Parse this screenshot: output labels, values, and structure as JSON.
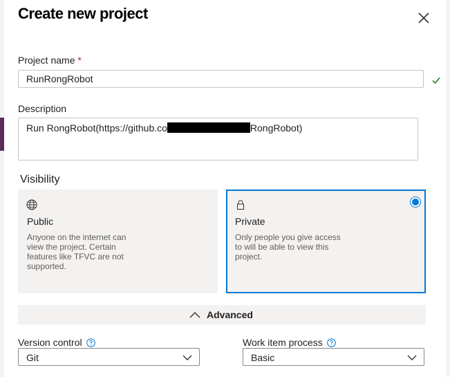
{
  "dialog": {
    "title": "Create new project",
    "project_name": {
      "label": "Project name",
      "required_marker": "*",
      "value": "RunRongRobot"
    },
    "description": {
      "label": "Description",
      "value_prefix": "Run RongRobot(https://github.co",
      "value_suffix": "RongRobot)"
    },
    "visibility": {
      "title": "Visibility",
      "options": [
        {
          "title": "Public",
          "description": "Anyone on the internet can view the project. Certain features like TFVC are not supported.",
          "icon": "globe-icon",
          "selected": false
        },
        {
          "title": "Private",
          "description": "Only people you give access to will be able to view this project.",
          "icon": "lock-icon",
          "selected": true
        }
      ]
    },
    "advanced": {
      "label": "Advanced"
    },
    "version_control": {
      "label": "Version control",
      "value": "Git"
    },
    "work_item_process": {
      "label": "Work item process",
      "value": "Basic"
    }
  },
  "colors": {
    "accent": "#0078d4",
    "valid": "#107c10",
    "required": "#a4262c"
  }
}
